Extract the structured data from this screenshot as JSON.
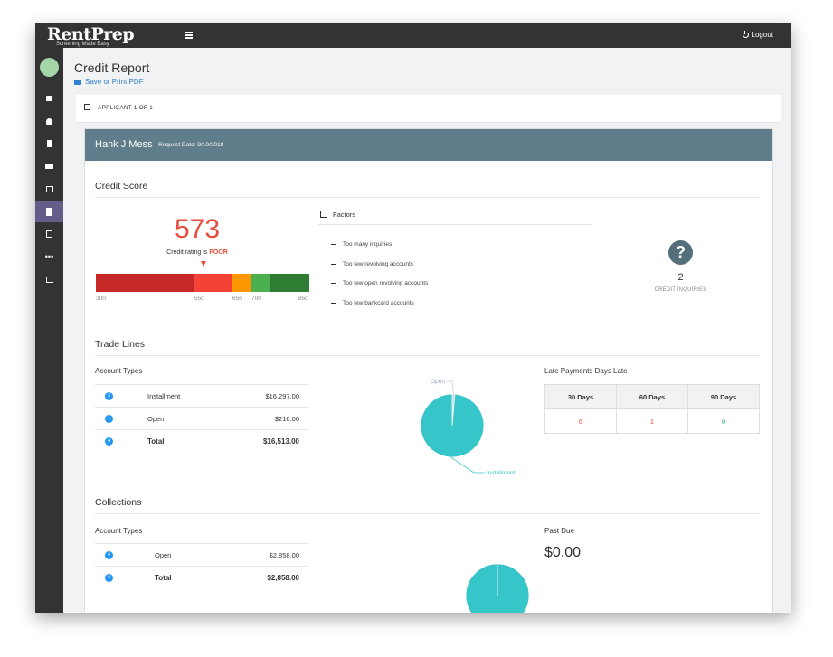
{
  "brand": {
    "name": "RentPrep",
    "tagline": "Screening Made Easy"
  },
  "topbar": {
    "logout_label": "Logout"
  },
  "header": {
    "title": "Credit Report",
    "print_label": "Save or Print PDF"
  },
  "applicant_bar": {
    "label": "APPLICANT 1 OF 1"
  },
  "applicant": {
    "name": "Hank J Mess",
    "request_date": "Request Date: 9/10/2018"
  },
  "credit_score": {
    "section_title": "Credit Score",
    "score": "573",
    "rating_prefix": "Credit rating is",
    "rating": "POOR",
    "gauge_ticks": [
      "300",
      "550",
      "650",
      "700",
      "850"
    ],
    "gauge_colors": [
      "#c62828",
      "#f44336",
      "#ff9800",
      "#4caf50",
      "#2e7d32"
    ]
  },
  "factors": {
    "title": "Factors",
    "items": [
      "Too many inquiries",
      "Too few revolving accounts",
      "Too few open revolving accounts",
      "Too few bankcard accounts"
    ]
  },
  "inquiries": {
    "count": "2",
    "label": "CREDIT INQUIRIES"
  },
  "trade_lines": {
    "section_title": "Trade Lines",
    "account_types_title": "Account Types",
    "rows": [
      {
        "count": "3",
        "type": "Installment",
        "amount": "$16,297.00"
      },
      {
        "count": "1",
        "type": "Open",
        "amount": "$216.00"
      }
    ],
    "total": {
      "count": "4",
      "label": "Total",
      "amount": "$16,513.00"
    },
    "late_payments": {
      "title": "Late Payments Days Late",
      "headers": [
        "30 Days",
        "60 Days",
        "90 Days"
      ],
      "values": [
        "6",
        "1",
        "0"
      ],
      "value_colors": [
        "#e74c3c",
        "#e74c3c",
        "#27ae60"
      ]
    }
  },
  "chart_data": [
    {
      "type": "pie",
      "labels": [
        "Open",
        "Installment"
      ],
      "values": [
        216.0,
        16297.0
      ],
      "colors": [
        "#c7d2e8",
        "#36c5c9"
      ]
    },
    {
      "type": "pie",
      "labels": [
        "Open"
      ],
      "values": [
        2858.0
      ],
      "colors": [
        "#36c5c9"
      ]
    }
  ],
  "collections": {
    "section_title": "Collections",
    "account_types_title": "Account Types",
    "rows": [
      {
        "count": "4",
        "type": "Open",
        "amount": "$2,858.00"
      }
    ],
    "total": {
      "count": "4",
      "label": "Total",
      "amount": "$2,858.00"
    },
    "past_due_label": "Past Due",
    "past_due": "$0.00"
  }
}
